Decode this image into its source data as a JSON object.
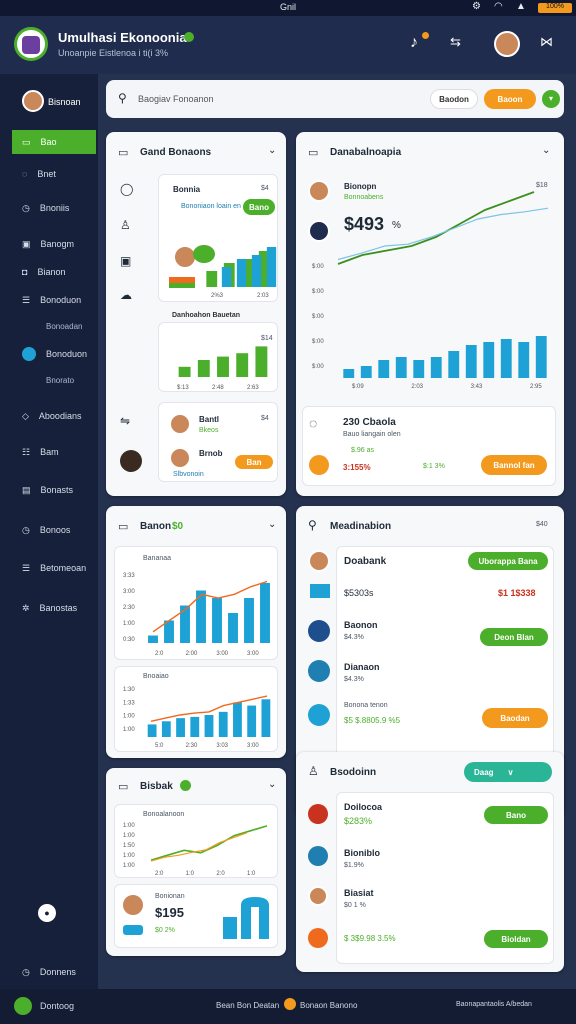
{
  "status_bar": {
    "center": "Gnil",
    "battery_label": "100%"
  },
  "header": {
    "title": "Umulhasi Ekonoonia",
    "subtitle": "Unoanpie Eistlenoa i ti(i 3%"
  },
  "sidebar": {
    "profile_name": "Bisnoan",
    "items": [
      {
        "label": "Bao"
      },
      {
        "label": "Bnet"
      },
      {
        "label": "Bnoniis"
      },
      {
        "label": "Banogm"
      },
      {
        "label": "Bianon"
      },
      {
        "label": "Bonoduon"
      },
      {
        "label": "Bonoadan"
      },
      {
        "label": "Bonoduon"
      },
      {
        "label": "Bnorato"
      },
      {
        "label": "Aboodians"
      },
      {
        "label": "Bam"
      },
      {
        "label": "Bonasts"
      },
      {
        "label": "Bonoos"
      },
      {
        "label": "Betomeoan"
      },
      {
        "label": "Banostas"
      },
      {
        "label": "Donnens"
      }
    ]
  },
  "search": {
    "placeholder": "Baogiav Fonoanon",
    "btn1": "Baodon",
    "btn2": "Baoon"
  },
  "card_general": {
    "title": "Gand Bonaons",
    "row1_title": "Bonnia",
    "row1_value": "$4",
    "row1_sub": "Bononiaon loain en",
    "row1_button": "Bano",
    "chart1_caption": "Danhoahon Bauetan",
    "chart1_labels": [
      "2%3",
      "2:03"
    ],
    "chart2_value": "$14",
    "chart2_labels": [
      "$:13",
      "2:48",
      "2:63"
    ],
    "person1_name": "Bantl",
    "person1_sub": "Bkeos",
    "person1_value": "$4",
    "person2_name": "Brnob",
    "person2_sub": "Slbvonoin",
    "person2_button": "Ban"
  },
  "card_analytics": {
    "title": "Danabalnoapia",
    "row1_title": "Bionopn",
    "row1_sub": "Bonnoabens",
    "big_value": "$493",
    "big_suffix": "%",
    "chart_label": "$18",
    "y_ticks": [
      "$:00",
      "$:00",
      "$:00",
      "$:00",
      "$:00"
    ],
    "x_labels": [
      "$:09",
      "2:03",
      "3:43",
      "2:95"
    ],
    "bottom_title": "230 Cbaola",
    "bottom_sub": "Bauo liangain olen",
    "bottom_stat1": "$.96 as",
    "bottom_stat2": "3:155%",
    "bottom_stat3": "$:1 3%",
    "bottom_button": "Bannol fan"
  },
  "card_finance": {
    "title": "Banon",
    "title_badge": "$0",
    "chart1_title": "Bananaa",
    "chart1_y_ticks": [
      "3:33",
      "3:00",
      "2:30",
      "1:00",
      "0:30"
    ],
    "chart1_x_labels": [
      "2:0",
      "2:00",
      "3:00",
      "3:00"
    ],
    "chart2_title": "Bnoaiao",
    "chart2_y_ticks": [
      "1:30",
      "1:33",
      "1:00",
      "1:00"
    ],
    "chart2_x_labels": [
      "5:0",
      "2:30",
      "3:03",
      "3:00"
    ]
  },
  "card_market": {
    "title": "Meadinabion",
    "header_right": "$40",
    "row1_title": "Doabank",
    "row1_button": "Uborappa Bana",
    "row1_value": "$5303s",
    "row1_value2": "$1 1$338",
    "row2_title": "Baonon",
    "row2_value": "$4.3%",
    "row2_button": "Deon Blan",
    "row3_title": "Dianaon",
    "row3_value": "$4.3%",
    "row4_title": "Bonona tenon",
    "row4_value": "$5 $.8805.9 %5",
    "row4_button": "Baodan"
  },
  "card_bank": {
    "title": "Bisbak",
    "chart_title": "Bonoalanoon",
    "y_ticks": [
      "1:00",
      "1:00",
      "1:50",
      "1:00",
      "1:00"
    ],
    "x_labels": [
      "2:0",
      "1:0",
      "2:0",
      "1:0"
    ],
    "bottom_title": "Bonionan",
    "bottom_value": "$195",
    "bottom_sub": "$0 2%"
  },
  "card_wallet": {
    "title": "Bsodoinn",
    "dropdown_label": "Daag",
    "rows": [
      {
        "title": "Doilocoa",
        "value": "$283%",
        "button": "Bano"
      },
      {
        "title": "Bioniblo",
        "value": "$1.9%",
        "button": ""
      },
      {
        "title": "Biasiat",
        "value": "$0 1 %",
        "button": ""
      },
      {
        "title": "",
        "value": "$ 3$9.98 3.5%",
        "button": "Bioldan"
      }
    ]
  },
  "footer": {
    "left": "Dontoog",
    "center1": "Bean Bon Deatan",
    "center2": "Bonaon Banono",
    "right": "Baonapantaolis A/bedan"
  },
  "colors": {
    "accent_green": "#4caf2b",
    "accent_orange": "#f39a1e",
    "accent_blue": "#1ea2d6",
    "sidebar": "#17203b"
  }
}
